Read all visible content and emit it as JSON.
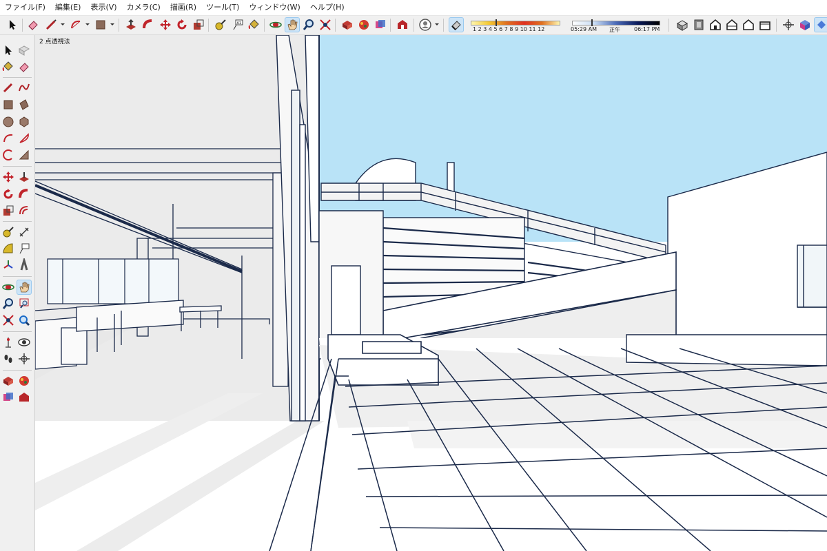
{
  "app": {
    "menu": [
      "ファイル(F)",
      "編集(E)",
      "表示(V)",
      "カメラ(C)",
      "描画(R)",
      "ツール(T)",
      "ウィンドウ(W)",
      "ヘルプ(H)"
    ]
  },
  "shadow": {
    "month_ticks": "1 2 3 4 5 6 7 8 9 10 11 12",
    "time_start": "05:29 AM",
    "time_noon": "正午",
    "time_end": "06:17 PM"
  },
  "scene": {
    "tab_label": "2 点透視法"
  },
  "colors": {
    "sky": "#b9e3f7",
    "line": "#1b2a4a",
    "shade": "#ebebeb"
  },
  "icons": {
    "top_toolbar": [
      "select-icon",
      "eraser-icon",
      "line-icon",
      "arc-icon",
      "rectangle-icon",
      "push-pull-icon",
      "follow-me-icon",
      "move-icon",
      "rotate-icon",
      "scale-icon",
      "tape-measure-icon",
      "text-icon",
      "paint-bucket-icon",
      "orbit-icon",
      "pan-icon",
      "zoom-icon",
      "zoom-extents-icon",
      "components-icon",
      "materials-icon",
      "styles-icon",
      "warehouse-icon",
      "user-icon",
      "shadow-toggle-icon",
      "iso-view-icon",
      "top-view-icon",
      "front-view-icon",
      "right-view-icon",
      "back-view-icon",
      "left-view-icon",
      "walk-icon",
      "xray-icon",
      "section-icon"
    ],
    "left_toolbar": [
      "select-icon",
      "component-icon",
      "paint-bucket-icon",
      "eraser-icon",
      "line-icon",
      "freehand-icon",
      "rectangle-icon",
      "rotated-rectangle-icon",
      "circle-icon",
      "polygon-icon",
      "arc-icon",
      "pie-icon",
      "three-point-arc-icon",
      "two-point-arc-icon",
      "move-icon",
      "push-pull-icon",
      "rotate-icon",
      "follow-me-icon",
      "scale-icon",
      "offset-icon",
      "tape-measure-icon",
      "dimension-icon",
      "protractor-icon",
      "text-icon",
      "axes-icon",
      "3d-text-icon",
      "orbit-icon",
      "pan-icon",
      "zoom-icon",
      "zoom-window-icon",
      "zoom-extents-icon",
      "previous-view-icon",
      "position-camera-icon",
      "look-around-icon",
      "walk-icon",
      "section-plane-icon",
      "components-icon",
      "warehouse-icon",
      "send-to-layout-icon",
      "extension-warehouse-icon"
    ]
  }
}
